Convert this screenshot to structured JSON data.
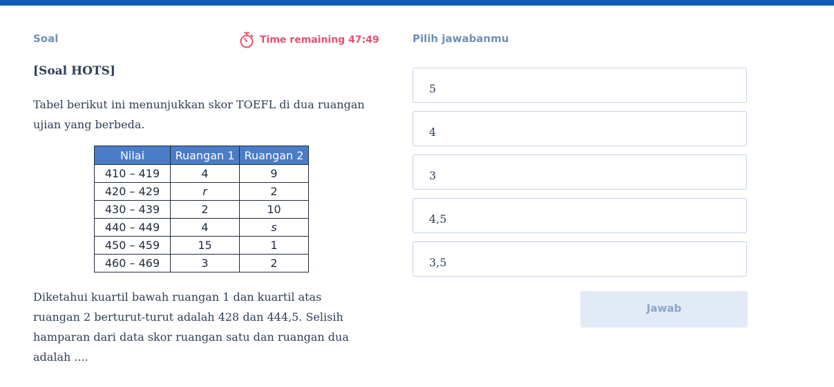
{
  "header": {
    "soal_label": "Soal",
    "timer_text": "Time remaining 47:49",
    "answer_label": "Pilih jawabanmu"
  },
  "question": {
    "title": "[Soal HOTS]",
    "intro": "Tabel berikut ini menunjukkan skor TOEFL di dua ruangan ujian yang berbeda.",
    "prompt": "Diketahui kuartil bawah ruangan 1 dan kuartil atas ruangan 2 berturut-turut adalah 428 dan 444,5. Selisih hamparan dari data skor ruangan satu dan ruangan dua adalah ...."
  },
  "table": {
    "headers": [
      "Nilai",
      "Ruangan 1",
      "Ruangan 2"
    ],
    "rows": [
      [
        "410 – 419",
        "4",
        "9"
      ],
      [
        "420 – 429",
        "r",
        "2"
      ],
      [
        "430 – 439",
        "2",
        "10"
      ],
      [
        "440 – 449",
        "4",
        "s"
      ],
      [
        "450 – 459",
        "15",
        "1"
      ],
      [
        "460 – 469",
        "3",
        "2"
      ]
    ]
  },
  "options": [
    "5",
    "4",
    "3",
    "4,5",
    "3,5"
  ],
  "submit_label": "Jawab",
  "colors": {
    "top_bar": "#0f5ab4",
    "label": "#6e8fb8",
    "timer": "#e8506c",
    "table_header": "#4a7cc7",
    "text": "#2d3e56"
  },
  "icons": {
    "timer": "stopwatch-icon"
  }
}
